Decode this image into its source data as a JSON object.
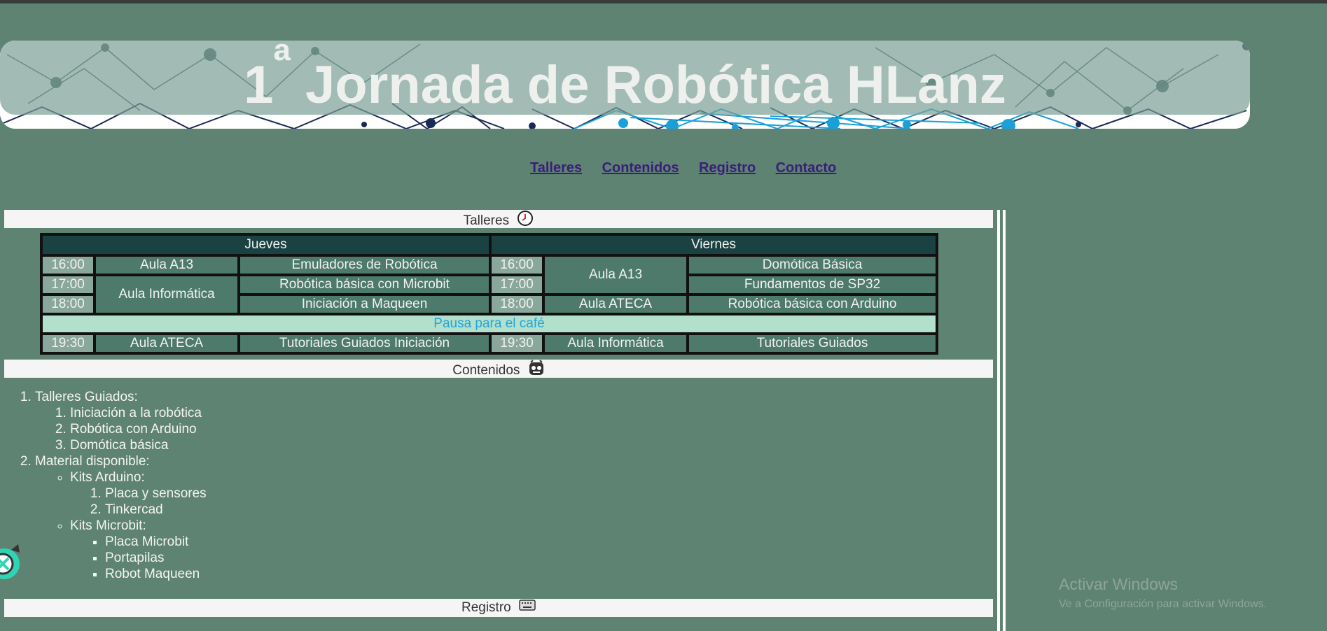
{
  "banner": {
    "title_main": "1",
    "title_sup": "a",
    "title_rest": " Jornada de Robótica HLanz"
  },
  "nav": {
    "items": [
      "Talleres",
      "Contenidos",
      "Registro",
      "Contacto"
    ]
  },
  "sections": {
    "talleres": {
      "label": "Talleres",
      "icon": "clock-icon"
    },
    "contenidos": {
      "label": "Contenidos",
      "icon": "robot-face-icon"
    },
    "registro": {
      "label": "Registro",
      "icon": "keyboard-icon"
    }
  },
  "schedule": {
    "days": [
      "Jueves",
      "Viernes"
    ],
    "thursday": {
      "rows": [
        {
          "time": "16:00",
          "room": "Aula A13",
          "activity": "Emuladores de Robótica"
        },
        {
          "time": "17:00",
          "room": "Aula Informática",
          "activity": "Robótica básica con Microbit"
        },
        {
          "time": "18:00",
          "activity": "Iniciación a Maqueen"
        },
        {
          "time": "19:30",
          "room": "Aula ATECA",
          "activity": "Tutoriales Guiados Iniciación"
        }
      ]
    },
    "friday": {
      "rows": [
        {
          "time": "16:00",
          "room": "Aula A13",
          "activity": "Domótica Básica"
        },
        {
          "time": "17:00",
          "activity": "Fundamentos de SP32"
        },
        {
          "time": "18:00",
          "room": "Aula ATECA",
          "activity": "Robótica básica con Arduino"
        },
        {
          "time": "19:30",
          "room": "Aula Informática",
          "activity": "Tutoriales Guiados"
        }
      ]
    },
    "pause": "Pausa para el café"
  },
  "contents": {
    "item1": "Talleres Guiados:",
    "item1_sub": [
      "Iniciación a la robótica",
      "Robótica con Arduino",
      "Domótica básica"
    ],
    "item2": "Material disponible:",
    "arduino": "Kits Arduino:",
    "arduino_sub": [
      "Placa y sensores",
      "Tinkercad"
    ],
    "microbit": "Kits Microbit:",
    "microbit_sub": [
      "Placa Microbit",
      "Portapilas",
      "Robot Maqueen"
    ]
  },
  "watermark": {
    "title": "Activar Windows",
    "subtitle": "Ve a Configuración para activar Windows."
  },
  "colors": {
    "background": "#5e8373",
    "table_header": "#1b4243",
    "pause_bg": "#b3e0cc",
    "pause_text": "#22a6d8",
    "link": "#3b1d7a"
  }
}
